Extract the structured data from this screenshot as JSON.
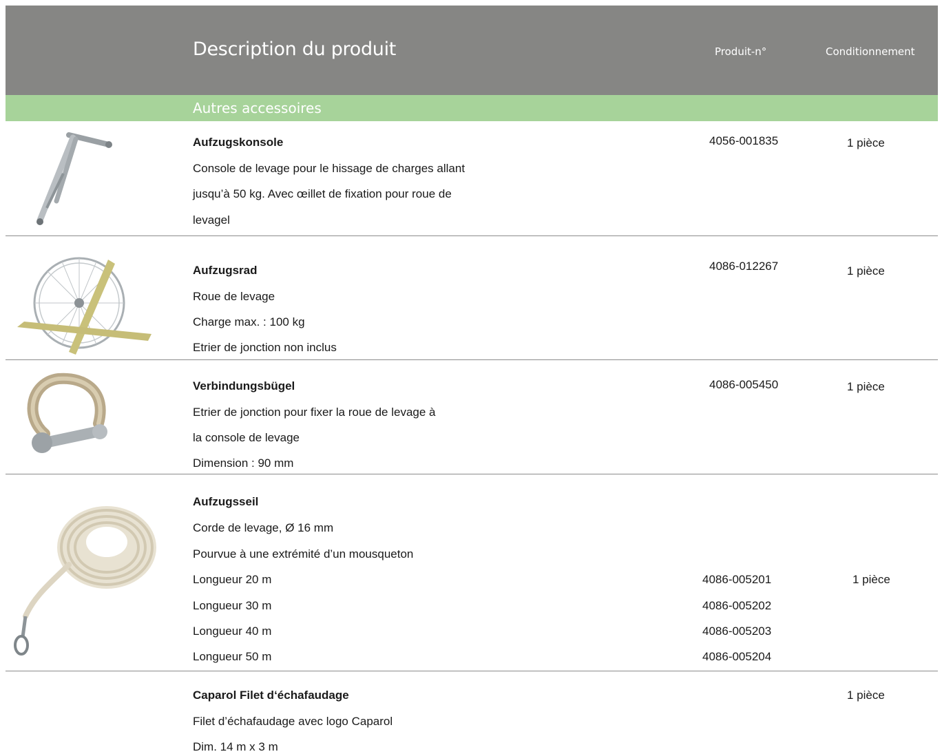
{
  "header": {
    "title": "Description du produit",
    "col_product_no": "Produit-n°",
    "col_packaging": "Conditionnement"
  },
  "section": {
    "title": "Autres accessoires"
  },
  "products": [
    {
      "name": "Aufzugskonsole",
      "lines": [
        "Console de levage pour le hissage de charges allant",
        "jusqu’à 50 kg. Avec œillet de fixation pour roue de",
        "levagel"
      ],
      "number": "4056-001835",
      "packaging": "1 pièce"
    },
    {
      "name": "Aufzugsrad",
      "lines": [
        "Roue de levage",
        "Charge max. : 100 kg",
        "Etrier de jonction non inclus"
      ],
      "number": "4086-012267",
      "packaging": "1 pièce"
    },
    {
      "name": "Verbindungsbügel",
      "lines": [
        "Etrier de jonction pour fixer la roue de levage à",
        "la console de levage",
        "Dimension : 90 mm"
      ],
      "number": "4086-005450",
      "packaging": "1 pièce"
    },
    {
      "name": "Aufzugsseil",
      "lines": [
        "Corde de levage, Ø 16 mm",
        "Pourvue à une extrémité d’un mousqueton"
      ],
      "variants": [
        {
          "label": "Longueur 20 m",
          "number": "4086-005201"
        },
        {
          "label": "Longueur 30 m",
          "number": "4086-005202"
        },
        {
          "label": "Longueur 40 m",
          "number": "4086-005203"
        },
        {
          "label": "Longueur 50 m",
          "number": "4086-005204"
        }
      ],
      "packaging": "1 pièce"
    },
    {
      "name": "Caparol Filet d‘échafaudage",
      "lines": [
        "Filet d’échafaudage avec logo Caparol",
        "Dim. 14 m x 3 m"
      ],
      "packaging": "1 pièce"
    }
  ]
}
